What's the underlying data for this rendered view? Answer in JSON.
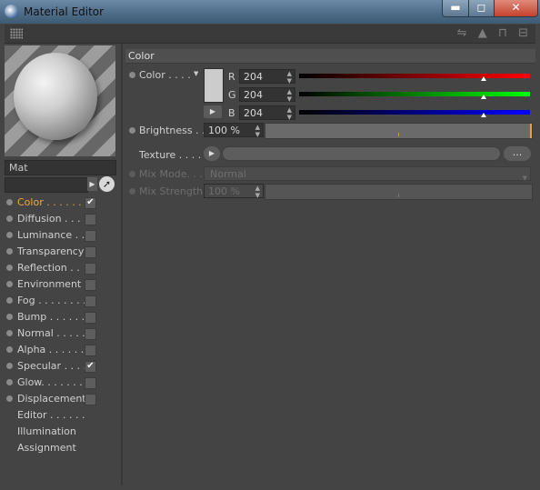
{
  "window": {
    "title": "Material Editor",
    "min": "▬",
    "max": "◻",
    "close": "✕"
  },
  "toolbar": {
    "icons": "⇋ ▲ ⊓ ⊟"
  },
  "material": {
    "name": "Mat",
    "picker_icon": "➚"
  },
  "channels": [
    {
      "label": "Color . . . . . .",
      "checked": true,
      "active": true,
      "dot": true
    },
    {
      "label": "Diffusion . . .",
      "checked": false,
      "dot": true
    },
    {
      "label": "Luminance . .",
      "checked": false,
      "dot": true
    },
    {
      "label": "Transparency",
      "checked": false,
      "dot": true
    },
    {
      "label": "Reflection . .",
      "checked": false,
      "dot": true
    },
    {
      "label": "Environment",
      "checked": false,
      "dot": true
    },
    {
      "label": "Fog . . . . . . . .",
      "checked": false,
      "dot": true
    },
    {
      "label": "Bump . . . . . .",
      "checked": false,
      "dot": true
    },
    {
      "label": "Normal . . . . .",
      "checked": false,
      "dot": true
    },
    {
      "label": "Alpha . . . . . .",
      "checked": false,
      "dot": true
    },
    {
      "label": "Specular . . . .",
      "checked": true,
      "dot": true
    },
    {
      "label": "Glow. . . . . . .",
      "checked": false,
      "dot": true
    },
    {
      "label": "Displacement",
      "checked": false,
      "dot": true
    },
    {
      "label": "Editor . . . . . .",
      "dot": false
    },
    {
      "label": "Illumination",
      "dot": false
    },
    {
      "label": "Assignment",
      "dot": false
    }
  ],
  "color_section": {
    "header": "Color",
    "color_label": "Color . . . .",
    "swatch": "#cccccc",
    "r_label": "R",
    "g_label": "G",
    "b_label": "B",
    "r": "204",
    "g": "204",
    "b": "204",
    "rgb_fraction": 0.8,
    "brightness_label": "Brightness . .",
    "brightness": "100 %",
    "texture_label": "Texture . . . . .",
    "texture_more": "...",
    "mix_mode_label": "Mix Mode. . .",
    "mix_mode": "Normal",
    "mix_strength_label": "Mix Strength",
    "mix_strength": "100 %"
  }
}
